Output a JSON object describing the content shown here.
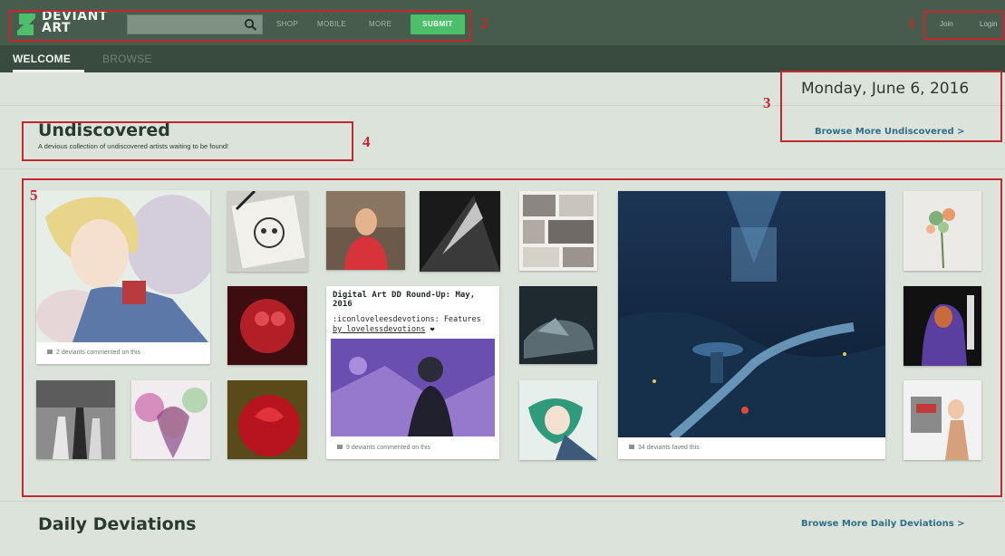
{
  "header": {
    "logo_line1": "DEVIANT",
    "logo_line2": "ART",
    "search": {
      "value": "",
      "placeholder": ""
    },
    "nav": [
      "SHOP",
      "MOBILE",
      "MORE"
    ],
    "submit_label": "SUBMIT",
    "join_label": "Join",
    "login_label": "Login"
  },
  "tabs": [
    {
      "label": "WELCOME",
      "active": true
    },
    {
      "label": "BROWSE",
      "active": false
    }
  ],
  "date": "Monday, June 6, 2016",
  "undiscovered": {
    "title": "Undiscovered",
    "subtitle": "A devious collection of undiscovered artists waiting to be found!",
    "browse_more": "Browse More Undiscovered >"
  },
  "tiles": {
    "anime_caption": "2 deviants commented on this",
    "dd_title": "Digital Art DD Round-Up: May, 2016",
    "dd_text_1": ":iconloveleesdevotions: Features",
    "dd_text_2": "by lovelessdevotions",
    "dd_caption": "9 deviants commented on this",
    "big_caption": "34 deviants faved this"
  },
  "daily": {
    "title": "Daily Deviations",
    "browse_more": "Browse More Daily Deviations >"
  },
  "annotations": [
    "1",
    "2",
    "3",
    "4",
    "5"
  ],
  "colors": {
    "topbar": "#475c4d",
    "tabsbar": "#394a3e",
    "page_bg": "#dbe3da",
    "submit": "#4dbf6b",
    "link": "#2f6f89",
    "annotation": "#c4282f"
  }
}
